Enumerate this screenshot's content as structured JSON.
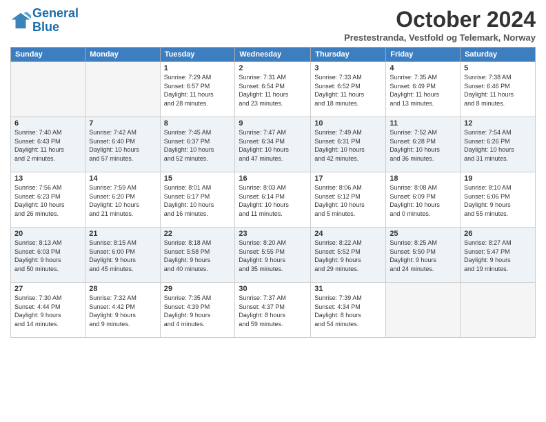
{
  "logo": {
    "line1": "General",
    "line2": "Blue"
  },
  "title": "October 2024",
  "subtitle": "Prestestranda, Vestfold og Telemark, Norway",
  "weekdays": [
    "Sunday",
    "Monday",
    "Tuesday",
    "Wednesday",
    "Thursday",
    "Friday",
    "Saturday"
  ],
  "weeks": [
    [
      {
        "day": "",
        "info": ""
      },
      {
        "day": "",
        "info": ""
      },
      {
        "day": "1",
        "info": "Sunrise: 7:29 AM\nSunset: 6:57 PM\nDaylight: 11 hours\nand 28 minutes."
      },
      {
        "day": "2",
        "info": "Sunrise: 7:31 AM\nSunset: 6:54 PM\nDaylight: 11 hours\nand 23 minutes."
      },
      {
        "day": "3",
        "info": "Sunrise: 7:33 AM\nSunset: 6:52 PM\nDaylight: 11 hours\nand 18 minutes."
      },
      {
        "day": "4",
        "info": "Sunrise: 7:35 AM\nSunset: 6:49 PM\nDaylight: 11 hours\nand 13 minutes."
      },
      {
        "day": "5",
        "info": "Sunrise: 7:38 AM\nSunset: 6:46 PM\nDaylight: 11 hours\nand 8 minutes."
      }
    ],
    [
      {
        "day": "6",
        "info": "Sunrise: 7:40 AM\nSunset: 6:43 PM\nDaylight: 11 hours\nand 2 minutes."
      },
      {
        "day": "7",
        "info": "Sunrise: 7:42 AM\nSunset: 6:40 PM\nDaylight: 10 hours\nand 57 minutes."
      },
      {
        "day": "8",
        "info": "Sunrise: 7:45 AM\nSunset: 6:37 PM\nDaylight: 10 hours\nand 52 minutes."
      },
      {
        "day": "9",
        "info": "Sunrise: 7:47 AM\nSunset: 6:34 PM\nDaylight: 10 hours\nand 47 minutes."
      },
      {
        "day": "10",
        "info": "Sunrise: 7:49 AM\nSunset: 6:31 PM\nDaylight: 10 hours\nand 42 minutes."
      },
      {
        "day": "11",
        "info": "Sunrise: 7:52 AM\nSunset: 6:28 PM\nDaylight: 10 hours\nand 36 minutes."
      },
      {
        "day": "12",
        "info": "Sunrise: 7:54 AM\nSunset: 6:26 PM\nDaylight: 10 hours\nand 31 minutes."
      }
    ],
    [
      {
        "day": "13",
        "info": "Sunrise: 7:56 AM\nSunset: 6:23 PM\nDaylight: 10 hours\nand 26 minutes."
      },
      {
        "day": "14",
        "info": "Sunrise: 7:59 AM\nSunset: 6:20 PM\nDaylight: 10 hours\nand 21 minutes."
      },
      {
        "day": "15",
        "info": "Sunrise: 8:01 AM\nSunset: 6:17 PM\nDaylight: 10 hours\nand 16 minutes."
      },
      {
        "day": "16",
        "info": "Sunrise: 8:03 AM\nSunset: 6:14 PM\nDaylight: 10 hours\nand 11 minutes."
      },
      {
        "day": "17",
        "info": "Sunrise: 8:06 AM\nSunset: 6:12 PM\nDaylight: 10 hours\nand 5 minutes."
      },
      {
        "day": "18",
        "info": "Sunrise: 8:08 AM\nSunset: 6:09 PM\nDaylight: 10 hours\nand 0 minutes."
      },
      {
        "day": "19",
        "info": "Sunrise: 8:10 AM\nSunset: 6:06 PM\nDaylight: 9 hours\nand 55 minutes."
      }
    ],
    [
      {
        "day": "20",
        "info": "Sunrise: 8:13 AM\nSunset: 6:03 PM\nDaylight: 9 hours\nand 50 minutes."
      },
      {
        "day": "21",
        "info": "Sunrise: 8:15 AM\nSunset: 6:00 PM\nDaylight: 9 hours\nand 45 minutes."
      },
      {
        "day": "22",
        "info": "Sunrise: 8:18 AM\nSunset: 5:58 PM\nDaylight: 9 hours\nand 40 minutes."
      },
      {
        "day": "23",
        "info": "Sunrise: 8:20 AM\nSunset: 5:55 PM\nDaylight: 9 hours\nand 35 minutes."
      },
      {
        "day": "24",
        "info": "Sunrise: 8:22 AM\nSunset: 5:52 PM\nDaylight: 9 hours\nand 29 minutes."
      },
      {
        "day": "25",
        "info": "Sunrise: 8:25 AM\nSunset: 5:50 PM\nDaylight: 9 hours\nand 24 minutes."
      },
      {
        "day": "26",
        "info": "Sunrise: 8:27 AM\nSunset: 5:47 PM\nDaylight: 9 hours\nand 19 minutes."
      }
    ],
    [
      {
        "day": "27",
        "info": "Sunrise: 7:30 AM\nSunset: 4:44 PM\nDaylight: 9 hours\nand 14 minutes."
      },
      {
        "day": "28",
        "info": "Sunrise: 7:32 AM\nSunset: 4:42 PM\nDaylight: 9 hours\nand 9 minutes."
      },
      {
        "day": "29",
        "info": "Sunrise: 7:35 AM\nSunset: 4:39 PM\nDaylight: 9 hours\nand 4 minutes."
      },
      {
        "day": "30",
        "info": "Sunrise: 7:37 AM\nSunset: 4:37 PM\nDaylight: 8 hours\nand 59 minutes."
      },
      {
        "day": "31",
        "info": "Sunrise: 7:39 AM\nSunset: 4:34 PM\nDaylight: 8 hours\nand 54 minutes."
      },
      {
        "day": "",
        "info": ""
      },
      {
        "day": "",
        "info": ""
      }
    ]
  ]
}
